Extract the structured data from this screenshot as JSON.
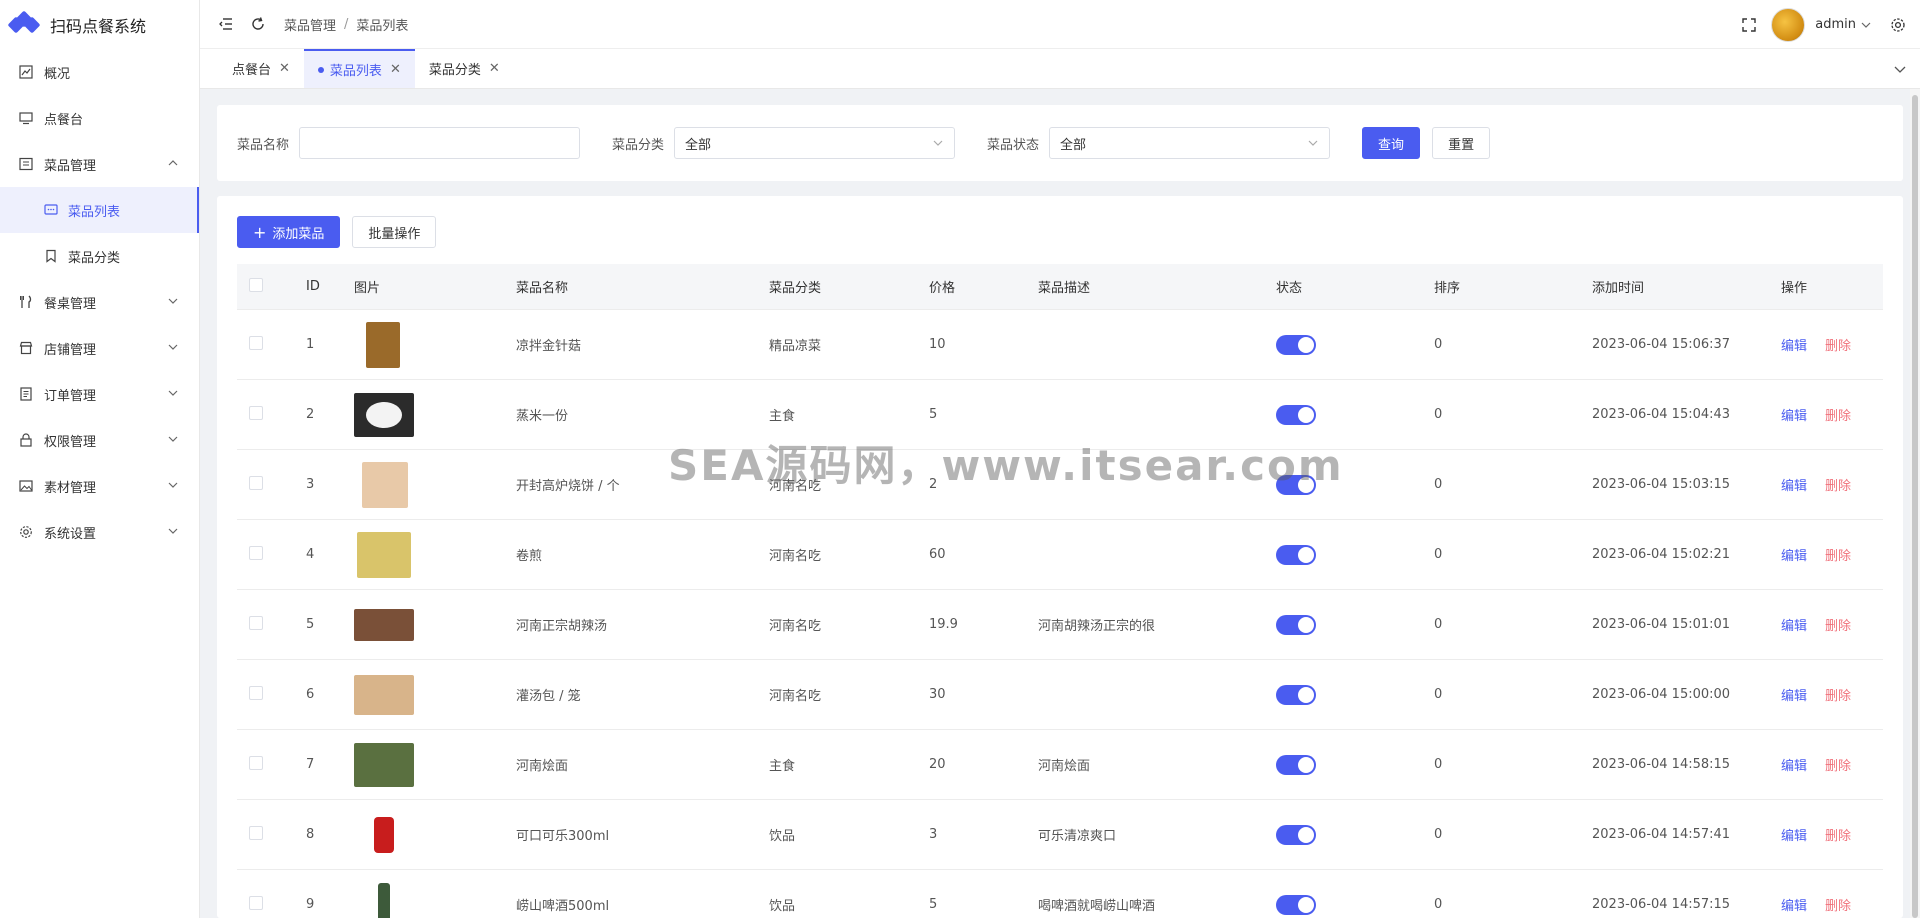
{
  "app": {
    "title": "扫码点餐系统"
  },
  "sidebar": {
    "items": [
      {
        "label": "概况",
        "icon": "chart-icon"
      },
      {
        "label": "点餐台",
        "icon": "monitor-icon"
      },
      {
        "label": "菜品管理",
        "icon": "list-icon",
        "expanded": true,
        "children": [
          {
            "label": "菜品列表",
            "icon": "message-icon",
            "active": true
          },
          {
            "label": "菜品分类",
            "icon": "bookmark-icon"
          }
        ]
      },
      {
        "label": "餐桌管理",
        "icon": "utensils-icon"
      },
      {
        "label": "店铺管理",
        "icon": "store-icon"
      },
      {
        "label": "订单管理",
        "icon": "document-icon"
      },
      {
        "label": "权限管理",
        "icon": "lock-icon"
      },
      {
        "label": "素材管理",
        "icon": "image-icon"
      },
      {
        "label": "系统设置",
        "icon": "gear-icon"
      }
    ]
  },
  "header": {
    "breadcrumb": [
      "菜品管理",
      "菜品列表"
    ],
    "username": "admin"
  },
  "tabs": [
    {
      "label": "点餐台",
      "active": false
    },
    {
      "label": "菜品列表",
      "active": true
    },
    {
      "label": "菜品分类",
      "active": false
    }
  ],
  "search": {
    "name_label": "菜品名称",
    "name_value": "",
    "category_label": "菜品分类",
    "category_value": "全部",
    "status_label": "菜品状态",
    "status_value": "全部",
    "query_button": "查询",
    "reset_button": "重置"
  },
  "toolbar": {
    "add_button": "添加菜品",
    "batch_button": "批量操作"
  },
  "table": {
    "columns": [
      "ID",
      "图片",
      "菜品名称",
      "菜品分类",
      "价格",
      "菜品描述",
      "状态",
      "排序",
      "添加时间",
      "操作"
    ],
    "edit_label": "编辑",
    "delete_label": "删除",
    "rows": [
      {
        "id": "1",
        "name": "凉拌金针菇",
        "category": "精品凉菜",
        "price": "10",
        "description": "",
        "status": true,
        "sort": "0",
        "time": "2023-06-04 15:06:37",
        "thumb": "#9a6a2a"
      },
      {
        "id": "2",
        "name": "蒸米一份",
        "category": "主食",
        "price": "5",
        "description": "",
        "status": true,
        "sort": "0",
        "time": "2023-06-04 15:04:43",
        "thumb": "#2b2b2b"
      },
      {
        "id": "3",
        "name": "开封高炉烧饼 / 个",
        "category": "河南名吃",
        "price": "2",
        "description": "",
        "status": true,
        "sort": "0",
        "time": "2023-06-04 15:03:15",
        "thumb": "#e8c9a8"
      },
      {
        "id": "4",
        "name": "卷煎",
        "category": "河南名吃",
        "price": "60",
        "description": "",
        "status": true,
        "sort": "0",
        "time": "2023-06-04 15:02:21",
        "thumb": "#d9c46a"
      },
      {
        "id": "5",
        "name": "河南正宗胡辣汤",
        "category": "河南名吃",
        "price": "19.9",
        "description": "河南胡辣汤正宗的很",
        "status": true,
        "sort": "0",
        "time": "2023-06-04 15:01:01",
        "thumb": "#7a5038"
      },
      {
        "id": "6",
        "name": "灌汤包 / 笼",
        "category": "河南名吃",
        "price": "30",
        "description": "",
        "status": true,
        "sort": "0",
        "time": "2023-06-04 15:00:00",
        "thumb": "#d8b48a"
      },
      {
        "id": "7",
        "name": "河南烩面",
        "category": "主食",
        "price": "20",
        "description": "河南烩面",
        "status": true,
        "sort": "0",
        "time": "2023-06-04 14:58:15",
        "thumb": "#5a7040"
      },
      {
        "id": "8",
        "name": "可口可乐300ml",
        "category": "饮品",
        "price": "3",
        "description": "可乐清凉爽口",
        "status": true,
        "sort": "0",
        "time": "2023-06-04 14:57:41",
        "thumb": "#c81d1d"
      },
      {
        "id": "9",
        "name": "崂山啤酒500ml",
        "category": "饮品",
        "price": "5",
        "description": "喝啤酒就喝崂山啤酒",
        "status": true,
        "sort": "0",
        "time": "2023-06-04 14:57:15",
        "thumb": "#3d5a3a"
      }
    ]
  },
  "watermark": "SEA源码网，www.itsear.com",
  "colors": {
    "accent": "#4a5cf0",
    "danger": "#f0707a"
  }
}
